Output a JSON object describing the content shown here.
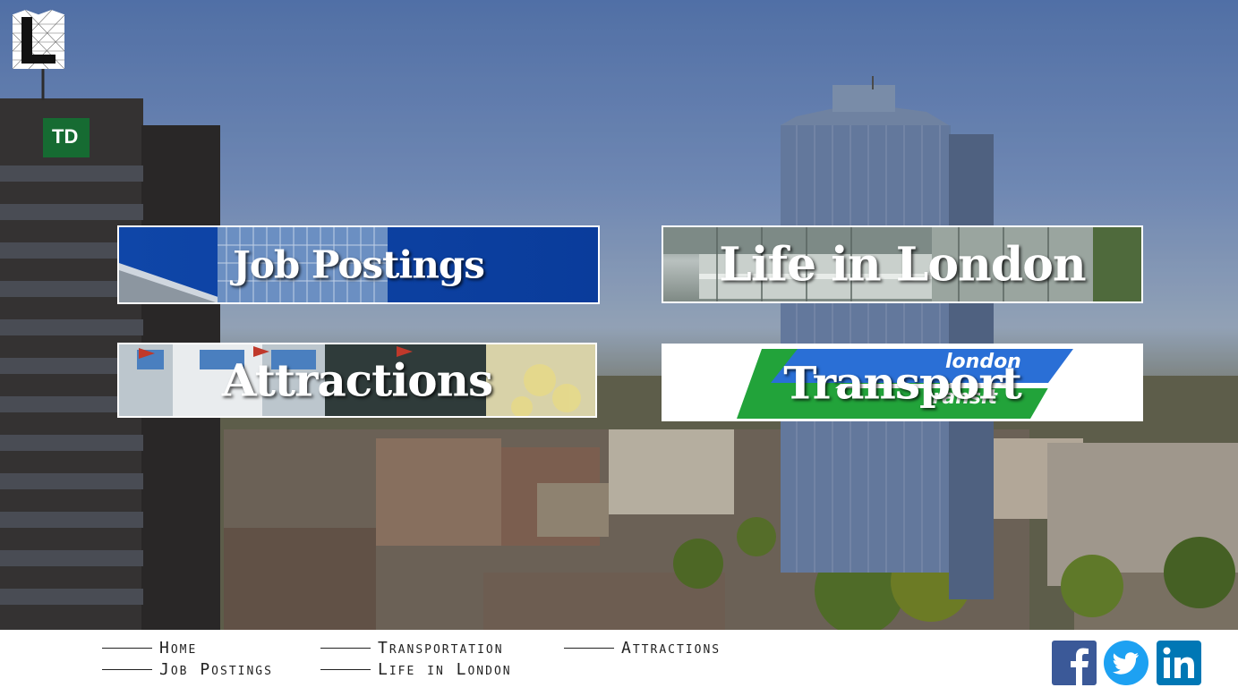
{
  "logo": {
    "icon": "city-logo-icon",
    "letter": "L"
  },
  "tiles": {
    "jobs": {
      "label": "Job Postings"
    },
    "life": {
      "label": "Life in London"
    },
    "attractions": {
      "label": "Attractions"
    },
    "transport": {
      "label": "Transport",
      "logo_text_1": "london",
      "logo_text_2": "transit"
    }
  },
  "background": {
    "building_sign": "TD"
  },
  "footer": {
    "nav": {
      "home": "Home",
      "jobs": "Job Postings",
      "transportation": "Transportation",
      "life": "Life in London",
      "attractions": "Attractions"
    },
    "social": {
      "facebook": "facebook-icon",
      "twitter": "twitter-icon",
      "linkedin": "linkedin-icon"
    }
  },
  "colors": {
    "jobs_blue": "#0a3c9b",
    "transit_blue": "#2a6fd6",
    "transit_green": "#22a33a",
    "facebook": "#3b5998",
    "twitter": "#1da1f2",
    "linkedin": "#0077b5"
  }
}
